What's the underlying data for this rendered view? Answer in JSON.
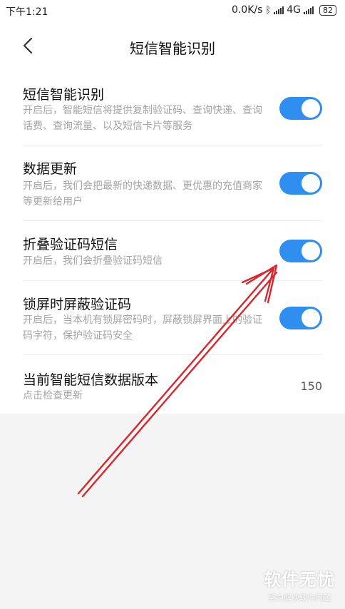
{
  "status_bar": {
    "time": "下午1:21",
    "speed": "0.0K/s",
    "network": "4G",
    "battery": "82"
  },
  "header": {
    "title": "短信智能识别"
  },
  "settings": [
    {
      "label": "短信智能识别",
      "desc": "开启后，智能短信将提供复制验证码、查询快递、查询话费、查询流量、以及短信卡片等服务",
      "enabled": true
    },
    {
      "label": "数据更新",
      "desc": "开启后，我们会把最新的快递数据、更优惠的充值商家等更新给用户",
      "enabled": true
    },
    {
      "label": "折叠验证码短信",
      "desc": "开启后，我们会折叠验证码短信",
      "enabled": true
    },
    {
      "label": "锁屏时屏蔽验证码",
      "desc": "开启后，当本机有锁屏密码时，屏蔽锁屏界面上的验证码字符，保护验证码安全",
      "enabled": true
    }
  ],
  "version_row": {
    "label": "当前智能短信数据版本",
    "desc": "点击检查更新",
    "value": "150"
  },
  "watermark": {
    "brand": "软件无忧",
    "slogan": "努力解决软件问题"
  },
  "colors": {
    "toggle_on": "#2f8ef0",
    "annotation_arrow": "#d9262c"
  }
}
